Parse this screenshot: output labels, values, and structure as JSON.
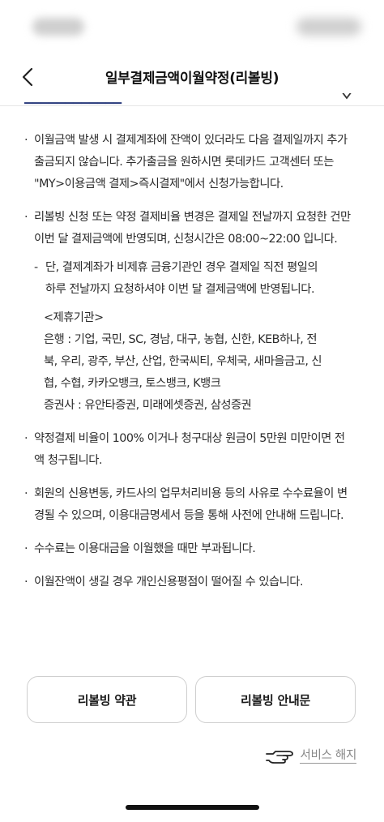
{
  "header": {
    "title": "일부결제금액이월약정(리볼빙)"
  },
  "notices": [
    "이월금액 발생 시 결제계좌에 잔액이 있더라도 다음 결제일까지 추가출금되지 않습니다. 추가출금을 원하시면 롯데카드 고객센터 또는 \"MY>이용금액 결제>즉시결제\"에서 신청가능합니다.",
    "리볼빙 신청 또는 약정 결제비율 변경은 결제일 전날까지 요청한 건만 이번 달 결제금액에 반영되며, 신청시간은 08:00~22:00 입니다.",
    "약정결제 비율이 100% 이거나 청구대상 원금이 5만원 미만이면 전액 청구됩니다.",
    "회원의 신용변동, 카드사의 업무처리비용 등의 사유로 수수료율이 변경될 수 있으며, 이용대금명세서 등을 통해 사전에 안내해 드립니다.",
    "수수료는 이용대금을 이월했을 때만 부과됩니다.",
    "이월잔액이 생길 경우 개인신용평점이 떨어질 수 있습니다."
  ],
  "sub_notice": "단, 결제계좌가 비제휴 금융기관인 경우 결제일 직전 평일의 하루 전날까지 요청하셔야 이번 달 결제금액에 반영됩니다.",
  "partners": {
    "heading": "<제휴기관>",
    "banks": "은행 : 기업, 국민, SC, 경남, 대구, 농협, 신한, KEB하나, 전북, 우리, 광주, 부산, 산업, 한국씨티, 우체국, 새마을금고, 신협, 수협, 카카오뱅크, 토스뱅크, K뱅크",
    "securities": "증권사 : 유안타증권, 미래에셋증권, 삼성증권"
  },
  "bullet": "·",
  "dash": "-",
  "buttons": {
    "terms": "리볼빙 약관",
    "guide": "리볼빙 안내문"
  },
  "cancel_link": "서비스 해지",
  "icons": {
    "back": "chevron-left-icon",
    "hand": "pointing-hand-icon"
  }
}
